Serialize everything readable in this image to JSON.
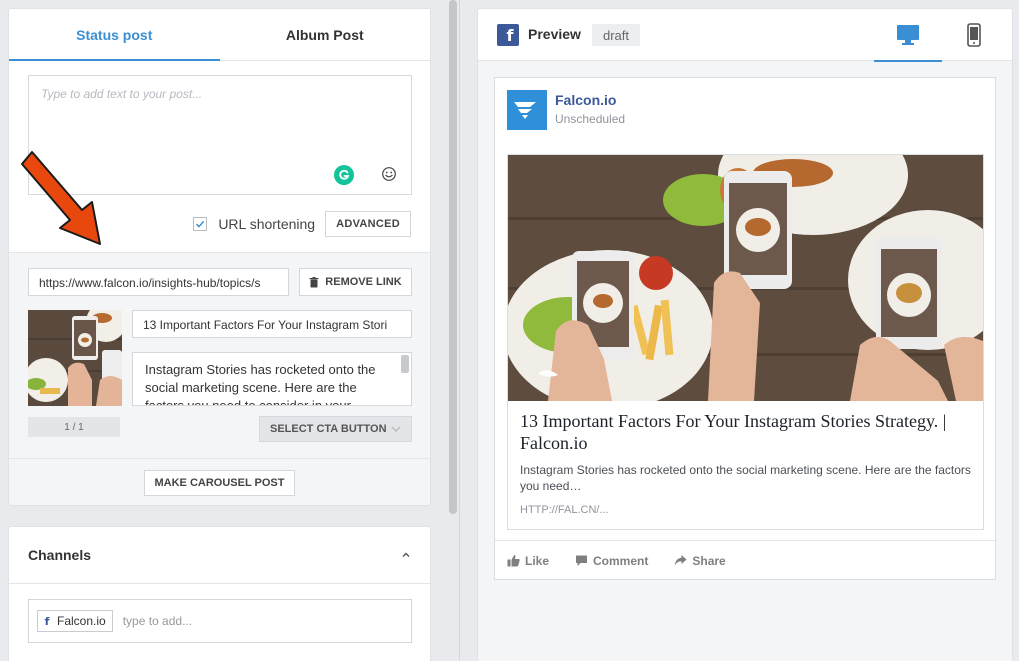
{
  "composer": {
    "tabs": [
      {
        "label": "Status post",
        "active": true
      },
      {
        "label": "Album Post",
        "active": false
      }
    ],
    "text_placeholder": "Type to add text to your post...",
    "url_shortening_label": "URL shortening",
    "url_shortening_checked": true,
    "advanced_label": "ADVANCED"
  },
  "link": {
    "url": "https://www.falcon.io/insights-hub/topics/s",
    "remove_label": "REMOVE LINK",
    "title": "13 Important Factors For Your Instagram Stori",
    "description": "Instagram Stories has rocketed onto the social marketing scene. Here are the factors you need to consider in your",
    "pager": "1 / 1",
    "cta_label": "SELECT CTA BUTTON",
    "carousel_label": "MAKE CAROUSEL POST"
  },
  "channels": {
    "title": "Channels",
    "tag": "Falcon.io",
    "placeholder": "type to add..."
  },
  "preview": {
    "label": "Preview",
    "status": "draft",
    "post": {
      "page_name": "Falcon.io",
      "schedule": "Unscheduled",
      "link_title": "13 Important Factors For Your Instagram Stories Strategy. | Falcon.io",
      "link_desc": "Instagram Stories has rocketed onto the social marketing scene. Here are the factors you need…",
      "link_domain": "HTTP://FAL.CN/..."
    },
    "actions": {
      "like": "Like",
      "comment": "Comment",
      "share": "Share"
    }
  },
  "colors": {
    "accent": "#3a8fd4",
    "facebook": "#3b5998",
    "arrow": "#e8470e",
    "grammarly": "#15c39a"
  }
}
